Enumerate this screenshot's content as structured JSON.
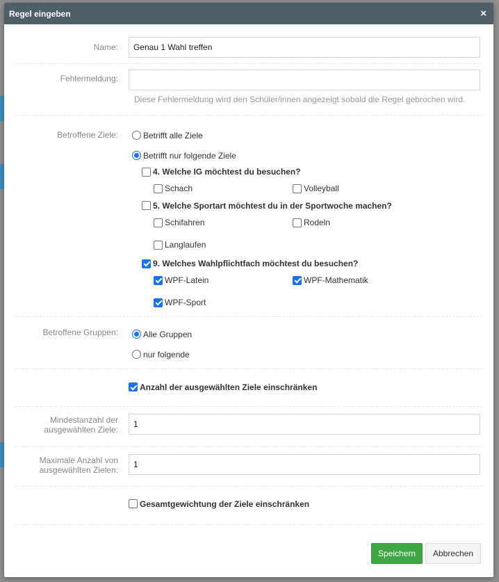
{
  "modal": {
    "title": "Regel eingeben",
    "close_icon": "×"
  },
  "form": {
    "name_label": "Name:",
    "name_value": "Genau 1 Wahl treffen",
    "error_label": "Fehlermeldung:",
    "error_value": "",
    "error_help": "Diese Fehlermeldung wird den Schüler/innen angezeigt sobald die Regel gebrochen wird.",
    "targets_label": "Betroffene Ziele:",
    "targets_all": "Betrifft alle Ziele",
    "targets_some": "Betrifft nur folgende Ziele",
    "questions": [
      {
        "label": "4. Welche IG möchtest du besuchen?",
        "checked": false,
        "options": [
          {
            "label": "Schach",
            "checked": false
          },
          {
            "label": "Volleyball",
            "checked": false
          }
        ]
      },
      {
        "label": "5. Welche Sportart möchtest du in der Sportwoche machen?",
        "checked": false,
        "options": [
          {
            "label": "Schifahren",
            "checked": false
          },
          {
            "label": "Rodeln",
            "checked": false
          },
          {
            "label": "Langlaufen",
            "checked": false
          }
        ]
      },
      {
        "label": "9. Welches Wahlpflichtfach möchtest du besuchen?",
        "checked": true,
        "options": [
          {
            "label": "WPF-Latein",
            "checked": true
          },
          {
            "label": "WPF-Mathematik",
            "checked": true
          },
          {
            "label": "WPF-Sport",
            "checked": true
          }
        ]
      }
    ],
    "groups_label": "Betroffene Gruppen:",
    "groups_all": "Alle Gruppen",
    "groups_some": "nur folgende",
    "limit_count_label": "Anzahl der ausgewählten Ziele einschränken",
    "min_label": "Mindestanzahl der ausgewählten Ziele:",
    "min_value": "1",
    "max_label": "Maximale Anzahl von ausgewählten Zielen:",
    "max_value": "1",
    "limit_weight_label": "Gesamtgewichtung der Ziele einschränken"
  },
  "footer": {
    "save_label": "Speichern",
    "cancel_label": "Abbrechen"
  },
  "colors": {
    "header": "#4f5e67",
    "accent": "#1a73e8",
    "save": "#3fa845"
  }
}
